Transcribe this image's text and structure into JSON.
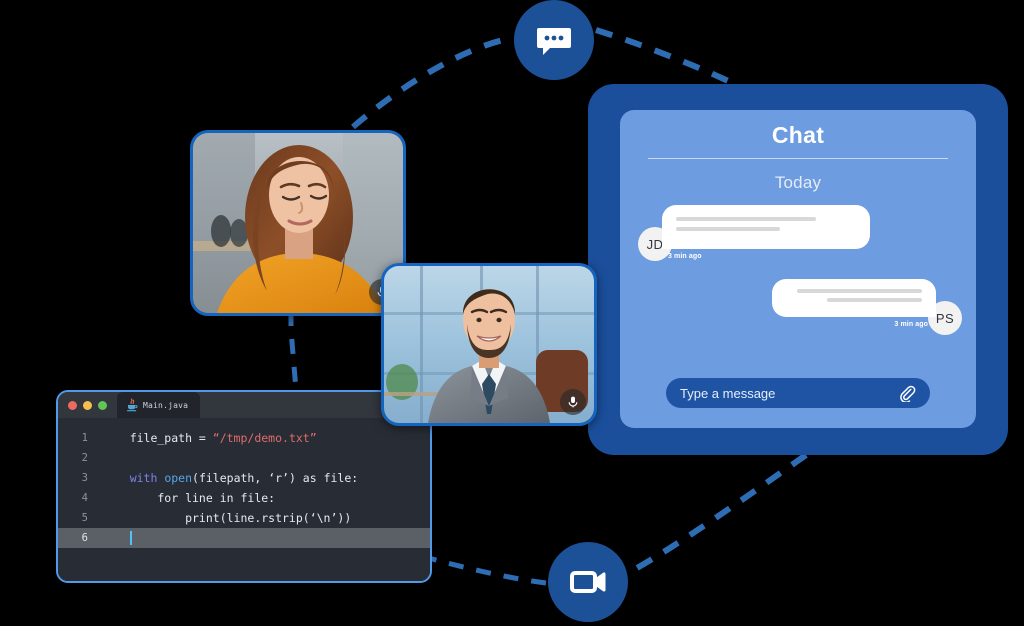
{
  "theme": {
    "background": "#000000",
    "node_blue": "#1d5197",
    "accent_blue": "#1565c0",
    "dash_blue": "#2e6db4",
    "chat_panel_blue": "#6d9ce0",
    "chat_frame_blue": "#1b4f9c",
    "chat_input_blue": "#1f54a5",
    "editor_bg": "#282c34",
    "editor_chrome": "#32363d",
    "caret": "#4fc3f7"
  },
  "nodes": [
    {
      "id": "chat-node",
      "icon": "chat-bubble-icon",
      "label": "Chat"
    },
    {
      "id": "video-node",
      "icon": "video-camera-icon",
      "label": "Video call"
    }
  ],
  "video_tiles": [
    {
      "id": "tile-woman",
      "participant": "Woman in orange top at a kitchen counter",
      "mic_icon": "microphone-icon"
    },
    {
      "id": "tile-man",
      "participant": "Smiling man in grey suit and navy tie in an office",
      "mic_icon": "microphone-icon"
    }
  ],
  "editor": {
    "window_controls": [
      "close",
      "minimize",
      "maximize"
    ],
    "tab": {
      "icon": "java-file-icon",
      "label": "Main.java"
    },
    "lines": [
      {
        "number": "1",
        "active": false,
        "tokens": [
          {
            "text": "    file_path = ",
            "type": "plain"
          },
          {
            "text": "“/tmp/demo.txt”",
            "type": "string"
          }
        ]
      },
      {
        "number": "2",
        "active": false,
        "tokens": [
          {
            "text": "",
            "type": "plain"
          }
        ]
      },
      {
        "number": "3",
        "active": false,
        "tokens": [
          {
            "text": "    ",
            "type": "plain"
          },
          {
            "text": "with ",
            "type": "keyword"
          },
          {
            "text": "open",
            "type": "function"
          },
          {
            "text": "(filepath, ‘r’) as file:",
            "type": "plain"
          }
        ]
      },
      {
        "number": "4",
        "active": false,
        "tokens": [
          {
            "text": "        for line in file:",
            "type": "plain"
          }
        ]
      },
      {
        "number": "5",
        "active": false,
        "tokens": [
          {
            "text": "            print(line.rstrip(‘\\n’))",
            "type": "plain"
          }
        ]
      },
      {
        "number": "6",
        "active": true,
        "tokens": [
          {
            "text": "    ",
            "type": "plain"
          },
          {
            "text": "",
            "type": "caret"
          }
        ]
      }
    ]
  },
  "chat": {
    "title": "Chat",
    "day_separator": "Today",
    "messages": [
      {
        "id": "message-incoming",
        "initials": "JD",
        "direction": "incoming",
        "timestamp": "3 min ago",
        "line_widths": [
          "78%",
          "58%"
        ]
      },
      {
        "id": "message-outgoing",
        "initials": "PS",
        "direction": "outgoing",
        "timestamp": "3 min ago",
        "line_widths": [
          "92%",
          "70%"
        ]
      }
    ],
    "composer": {
      "placeholder": "Type a message",
      "attach_icon": "paperclip-icon"
    }
  }
}
